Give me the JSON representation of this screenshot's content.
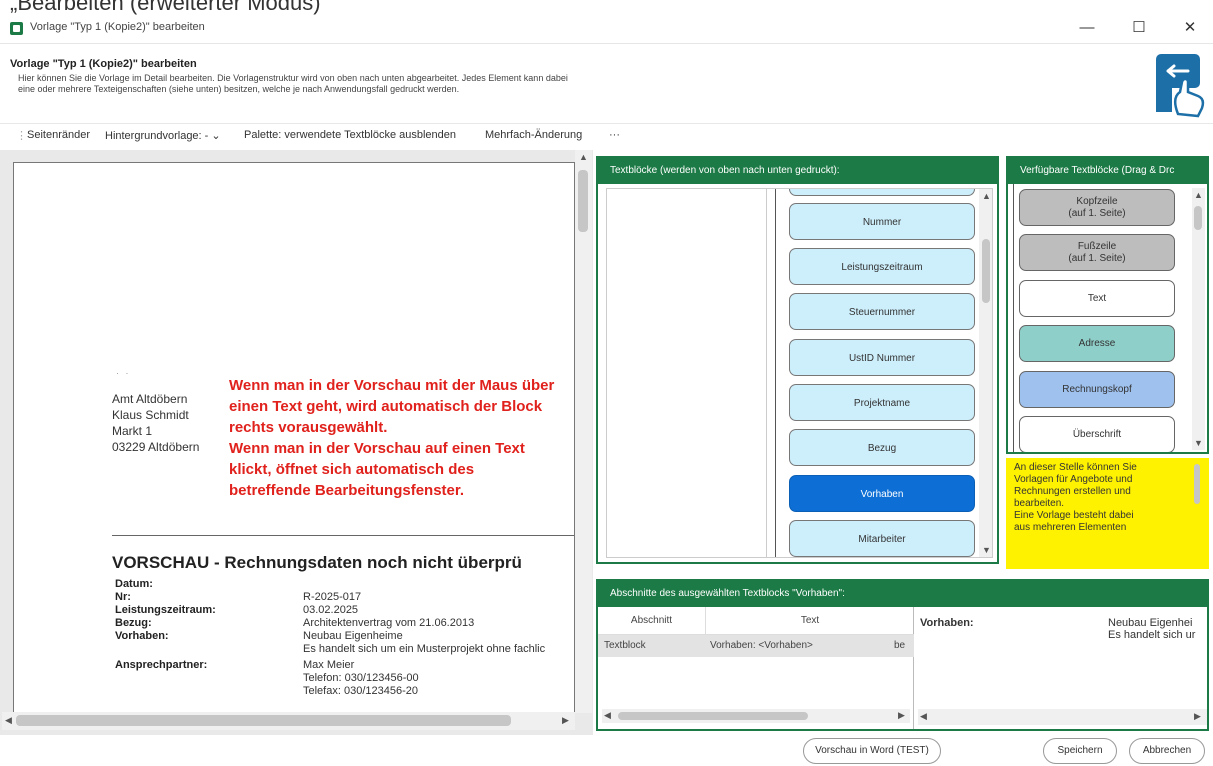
{
  "caption": "„Bearbeiten (erweiterter Modus)",
  "window": {
    "title": "Vorlage \"Typ 1 (Kopie2)\" bearbeiten",
    "minimize": "—",
    "maximize": "☐",
    "close": "✕"
  },
  "header": {
    "title": "Vorlage \"Typ 1 (Kopie2)\" bearbeiten",
    "desc_line1": "Hier können Sie die Vorlage im Detail bearbeiten. Die Vorlagenstruktur wird von oben nach unten abgearbeitet. Jedes Element kann dabei",
    "desc_line2": "eine oder mehrere Texteigenschaften (siehe unten) besitzen, welche je nach Anwendungsfall gedruckt werden."
  },
  "toolbar": {
    "seitenraender": "Seitenränder",
    "hintergrund": "Hintergrundvorlage: -",
    "hintergrund_arrow": "⌄",
    "palette": "Palette: verwendete Textblöcke ausblenden",
    "mehrfach": "Mehrfach-Änderung",
    "more": "···"
  },
  "preview": {
    "dots": "· ·",
    "address": [
      "Amt Altdöbern",
      "Klaus Schmidt",
      "Markt 1",
      "03229 Altdöbern"
    ],
    "annotation": [
      "Wenn man in der Vorschau mit der Maus über",
      "einen Text geht, wird automatisch der Block",
      "rechts vorausgewählt.",
      "Wenn man in der Vorschau auf einen Text",
      "klickt, öffnet sich automatisch des",
      "betreffende Bearbeitungsfenster."
    ],
    "title": "VORSCHAU - Rechnungsdaten noch nicht überprü",
    "rows": [
      {
        "key": "Datum:",
        "values": [
          ""
        ]
      },
      {
        "key": "Nr:",
        "values": [
          "R-2025-017"
        ]
      },
      {
        "key": "Leistungszeitraum:",
        "values": [
          "03.02.2025"
        ]
      },
      {
        "key": "Bezug:",
        "values": [
          "Architektenvertrag vom 21.06.2013"
        ]
      },
      {
        "key": "Vorhaben:",
        "values": [
          "Neubau Eigenheime",
          "Es handelt sich um ein Musterprojekt ohne fachlic"
        ]
      },
      {
        "key": "Ansprechpartner:",
        "values": [
          "Max Meier",
          "Telefon: 030/123456-00",
          "Telefax: 030/123456-20"
        ]
      }
    ]
  },
  "textbloecke": {
    "header": "Textblöcke (werden von oben nach unten gedruckt):",
    "items": [
      "Nummer",
      "Leistungszeitraum",
      "Steuernummer",
      "UstID Nummer",
      "Projektname",
      "Bezug",
      "Vorhaben",
      "Mitarbeiter"
    ],
    "selected": "Vorhaben"
  },
  "verfuegbar": {
    "header": "Verfügbare Textblöcke (Drag & Drc",
    "items": [
      {
        "line1": "Kopfzeile",
        "line2": "(auf 1. Seite)",
        "color": "#bdbdbd"
      },
      {
        "line1": "Fußzeile",
        "line2": "(auf 1. Seite)",
        "color": "#bdbdbd"
      },
      {
        "line1": "Text",
        "line2": "",
        "color": "#ffffff"
      },
      {
        "line1": "Adresse",
        "line2": "",
        "color": "#8fcfc9"
      },
      {
        "line1": "Rechnungskopf",
        "line2": "",
        "color": "#9fc1ee"
      },
      {
        "line1": "Überschrift",
        "line2": "",
        "color": "#ffffff"
      }
    ]
  },
  "hint": {
    "lines": [
      "An dieser Stelle können Sie",
      "Vorlagen für Angebote und",
      "Rechnungen erstellen und",
      "bearbeiten.",
      "Eine Vorlage besteht dabei",
      "aus mehreren Elementen"
    ]
  },
  "abschnitte": {
    "header": "Abschnitte des ausgewählten Textblocks \"Vorhaben\":",
    "col_abschnitt": "Abschnitt",
    "col_text": "Text",
    "row_abschnitt": "Textblock",
    "row_text": "Vorhaben: <Vorhaben>",
    "row_extra": "be"
  },
  "detail": {
    "key": "Vorhaben:",
    "line1": "Neubau Eigenhei",
    "line2": "Es handelt sich ur"
  },
  "buttons": {
    "word": "Vorschau in Word (TEST)",
    "save": "Speichern",
    "cancel": "Abbrechen"
  },
  "colors": {
    "accent": "#1b7a45",
    "selected": "#0d6fd6",
    "block": "#cdeefb",
    "annotation": "#e0211c",
    "hint_bg": "#fff200"
  }
}
